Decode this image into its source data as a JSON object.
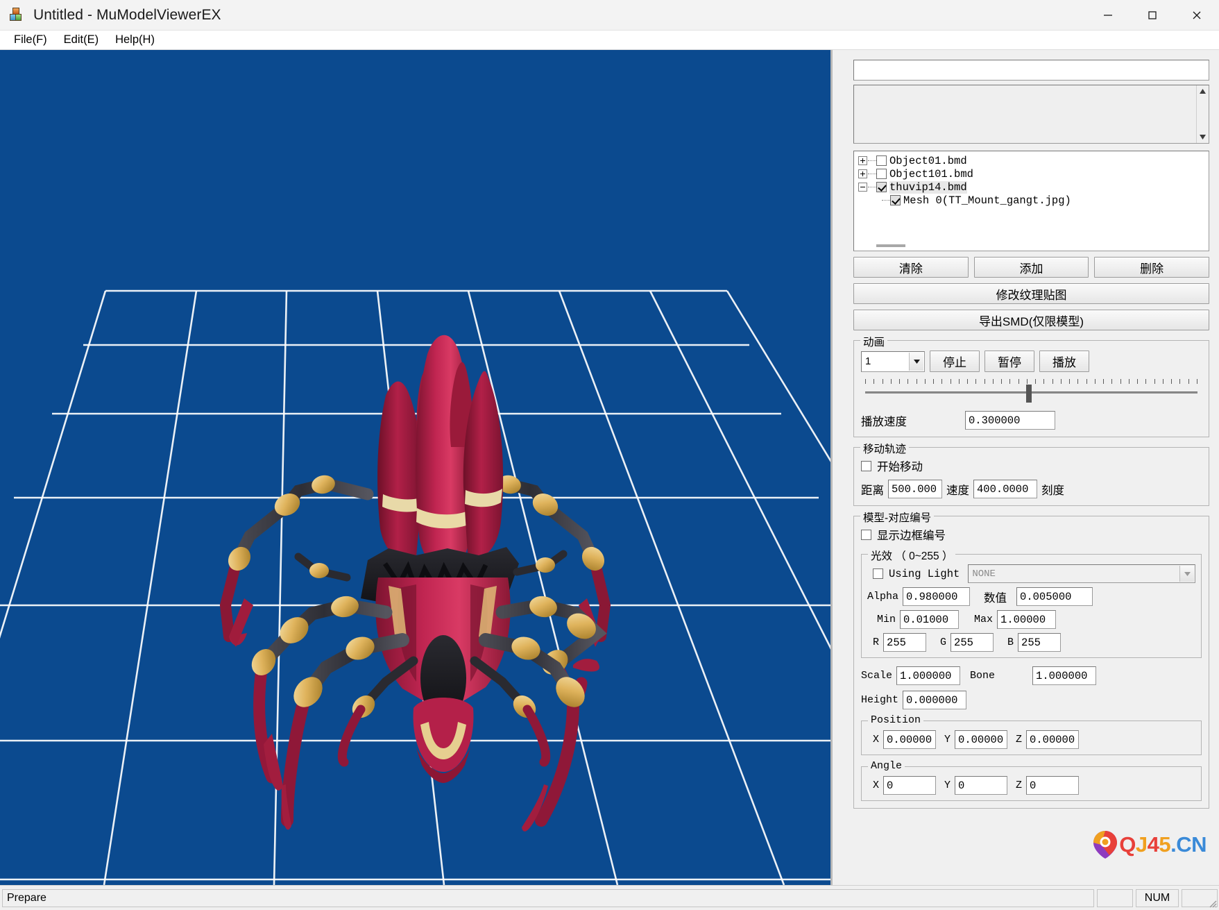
{
  "window": {
    "title": "Untitled - MuModelViewerEX",
    "icon": "app-blocks-icon",
    "minimize": "minimize-icon",
    "maximize": "maximize-icon",
    "close": "close-icon"
  },
  "menubar": {
    "items": [
      {
        "label": "File(F)"
      },
      {
        "label": "Edit(E)"
      },
      {
        "label": "Help(H)"
      }
    ]
  },
  "viewport": {
    "background_color": "#0b4a8f",
    "grid_color": "#ffffff",
    "model_name": "thuvip14.bmd",
    "model_colors": {
      "crimson": "#b81f4a",
      "crimson_dark": "#7d1430",
      "gold": "#e8c87a",
      "gold_dark": "#b08a30",
      "dark_metal": "#3a3a40",
      "black": "#1a1a1e"
    }
  },
  "panel": {
    "name_edit": {
      "value": "",
      "placeholder": ""
    },
    "listbox": {
      "items": []
    },
    "tree": {
      "items": [
        {
          "expander": "plus",
          "checked": false,
          "label": "Object01.bmd",
          "indent": false,
          "selected": false
        },
        {
          "expander": "plus",
          "checked": false,
          "label": "Object101.bmd",
          "indent": false,
          "selected": false
        },
        {
          "expander": "minus",
          "checked": true,
          "label": "thuvip14.bmd",
          "indent": false,
          "selected": true
        },
        {
          "expander": "none",
          "checked": true,
          "label": "Mesh 0(TT_Mount_gangt.jpg)",
          "indent": true,
          "selected": false
        }
      ]
    },
    "buttons": {
      "clear": "清除",
      "add": "添加",
      "delete": "删除",
      "modify_texture": "修改纹理贴图",
      "export_smd": "导出SMD(仅限模型)"
    },
    "animation": {
      "group_title": "动画",
      "combo_value": "1",
      "stop": "停止",
      "pause": "暂停",
      "play": "播放",
      "speed_label": "播放速度",
      "speed_value": "0.300000",
      "slider_percent": 49
    },
    "movement": {
      "group_title": "移动轨迹",
      "start_move_label": "开始移动",
      "start_move_checked": false,
      "distance_label": "距离",
      "distance_value": "500.000",
      "speed_label": "速度",
      "speed_value": "400.0000",
      "unit_label": "刻度"
    },
    "model_number": {
      "group_title": "模型-对应编号",
      "show_frame_number_label": "显示边框编号",
      "show_frame_number_checked": false,
      "light": {
        "group_title": "光效 （ 0~255 ）",
        "using_light_label": "Using Light",
        "using_light_checked": false,
        "light_combo_value": "NONE",
        "alpha_label": "Alpha",
        "alpha_value": "0.980000",
        "numeric_label": "数值",
        "numeric_value": "0.005000",
        "min_label": "Min",
        "min_value": "0.01000",
        "max_label": "Max",
        "max_value": "1.00000",
        "r_label": "R",
        "r_value": "255",
        "g_label": "G",
        "g_value": "255",
        "b_label": "B",
        "b_value": "255"
      },
      "scale_label": "Scale",
      "scale_value": "1.000000",
      "bone_label": "Bone",
      "bone_value": "1.000000",
      "height_label": "Height",
      "height_value": "0.000000",
      "position": {
        "group_title": "Position",
        "x_label": "X",
        "x_value": "0.00000",
        "y_label": "Y",
        "y_value": "0.00000",
        "z_label": "Z",
        "z_value": "0.00000"
      },
      "angle": {
        "group_title": "Angle",
        "x_label": "X",
        "x_value": "0",
        "y_label": "Y",
        "y_value": "0",
        "z_label": "Z",
        "z_value": "0"
      }
    }
  },
  "statusbar": {
    "message": "Prepare",
    "pane_empty_1": "",
    "num_indicator": "NUM",
    "pane_empty_2": ""
  },
  "watermark": {
    "q": "Q",
    "j": "J",
    "four": "4",
    "five": "5",
    "dot": ".",
    "cn": "CN",
    "pin_icon": "map-pin-icon"
  }
}
